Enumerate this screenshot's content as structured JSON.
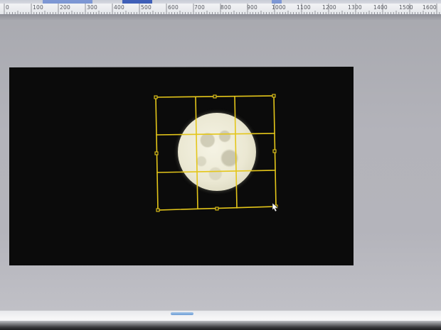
{
  "ruler": {
    "unit_label": "0",
    "marks": [
      "100",
      "200",
      "300",
      "400",
      "500",
      "600",
      "700",
      "800",
      "900",
      "1000",
      "1100",
      "1200",
      "1300",
      "1400",
      "1500",
      "1600"
    ]
  },
  "colors": {
    "selection": "#e4c61a",
    "canvas_background": "#0b0b0b",
    "workspace": "#b3b3ba"
  },
  "icons": {
    "resize_cursor": "resize-cursor-icon"
  }
}
